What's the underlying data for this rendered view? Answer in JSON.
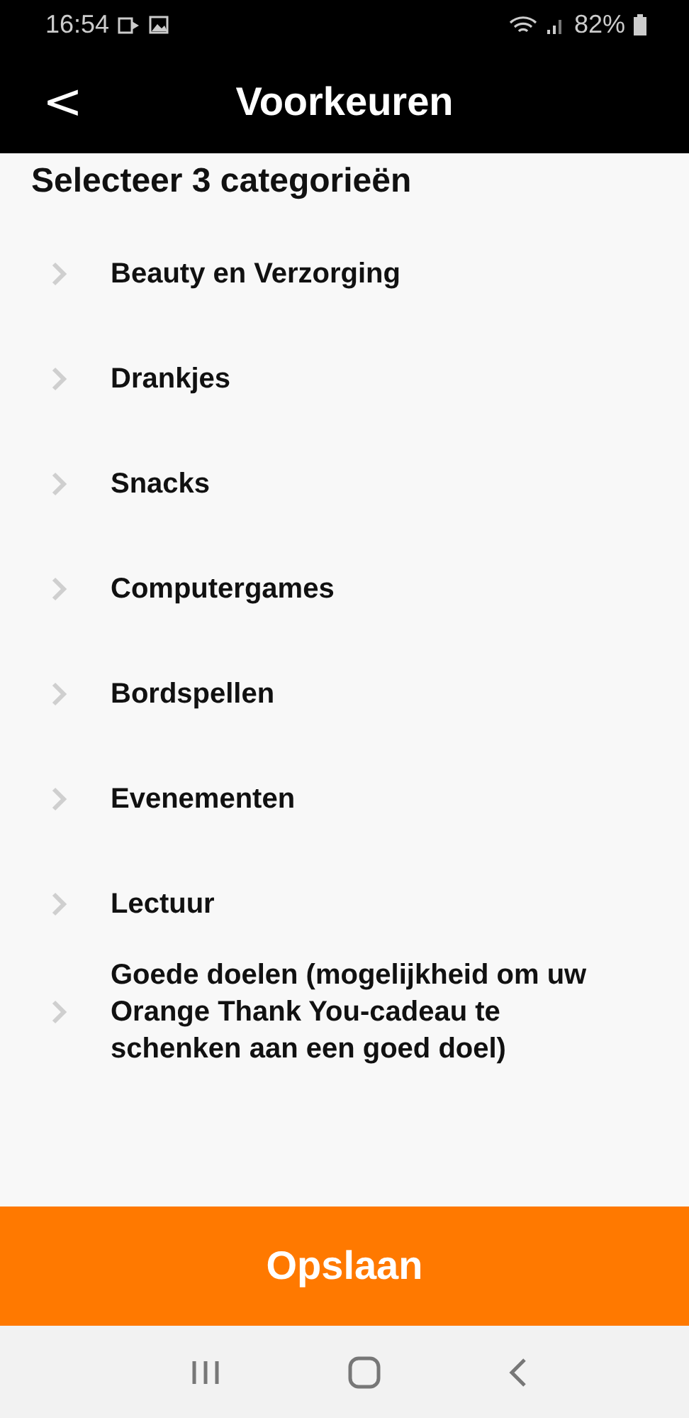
{
  "status_bar": {
    "time": "16:54",
    "battery": "82%"
  },
  "header": {
    "back": "<",
    "title": "Voorkeuren"
  },
  "heading": "Selecteer 3 categorieën",
  "categories": [
    {
      "label": "Beauty en Verzorging"
    },
    {
      "label": "Drankjes"
    },
    {
      "label": "Snacks"
    },
    {
      "label": "Computergames"
    },
    {
      "label": "Bordspellen"
    },
    {
      "label": "Evenementen"
    },
    {
      "label": "Lectuur"
    },
    {
      "label": "Goede doelen (mogelijkheid om uw Orange Thank You-cadeau te schenken aan een goed doel)"
    }
  ],
  "save_button": "Opslaan"
}
